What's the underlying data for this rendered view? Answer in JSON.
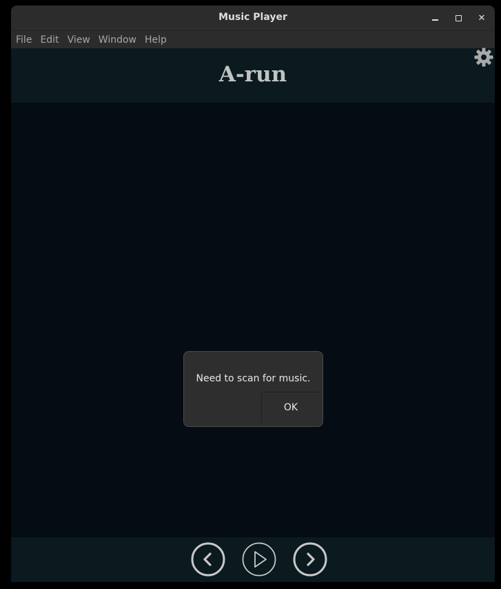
{
  "window": {
    "title": "Music Player",
    "controls": {
      "minimize_icon": "minimize-icon",
      "maximize_icon": "maximize-icon",
      "close_icon": "close-icon",
      "close_glyph": "✕"
    }
  },
  "menubar": {
    "items": [
      {
        "label": "File"
      },
      {
        "label": "Edit"
      },
      {
        "label": "View"
      },
      {
        "label": "Window"
      },
      {
        "label": "Help"
      }
    ]
  },
  "header": {
    "title": "A-run",
    "settings_icon": "gear-icon"
  },
  "dialog": {
    "message": "Need to scan for music.",
    "ok_label": "OK"
  },
  "player_controls": {
    "previous_icon": "chevron-left-icon",
    "play_icon": "play-icon",
    "next_icon": "chevron-right-icon"
  },
  "colors": {
    "titlebar": "#2c2c2c",
    "header_bg": "#0a1a1f",
    "content_bg": "#060c13",
    "dialog_bg": "#2e2e2e",
    "text_light": "#e8e8e8",
    "control_outline": "#c8c8c8"
  }
}
